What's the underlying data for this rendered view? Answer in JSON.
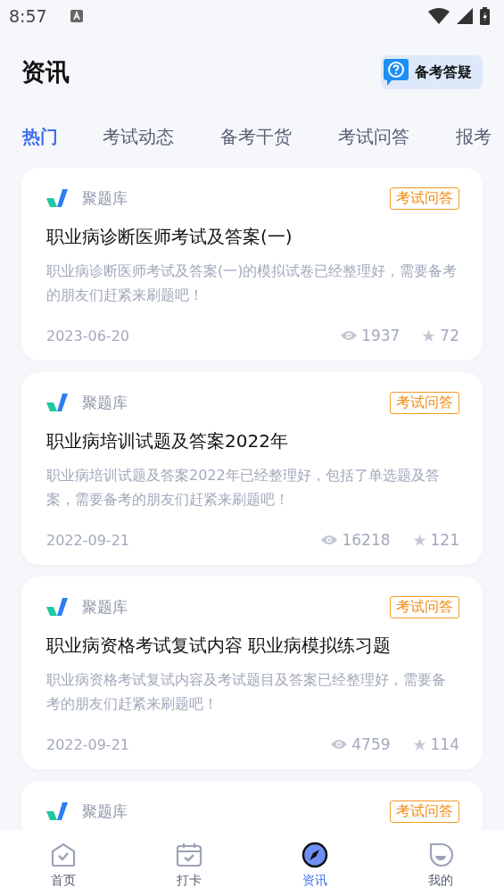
{
  "status_bar": {
    "time": "8:57"
  },
  "header": {
    "title": "资讯",
    "qa_button": "备考答疑"
  },
  "tabs": [
    {
      "label": "热门",
      "selected": true
    },
    {
      "label": "考试动态",
      "selected": false
    },
    {
      "label": "备考干货",
      "selected": false
    },
    {
      "label": "考试问答",
      "selected": false
    },
    {
      "label": "报考",
      "selected": false
    }
  ],
  "articles": [
    {
      "source": "聚题库",
      "tag": "考试问答",
      "title": "职业病诊断医师考试及答案(一)",
      "summary": "职业病诊断医师考试及答案(一)的模拟试卷已经整理好，需要备考的朋友们赶紧来刷题吧！",
      "date": "2023-06-20",
      "views": "1937",
      "favorites": "72"
    },
    {
      "source": "聚题库",
      "tag": "考试问答",
      "title": "职业病培训试题及答案2022年",
      "summary": "职业病培训试题及答案2022年已经整理好，包括了单选题及答案，需要备考的朋友们赶紧来刷题吧！",
      "date": "2022-09-21",
      "views": "16218",
      "favorites": "121"
    },
    {
      "source": "聚题库",
      "tag": "考试问答",
      "title": "职业病资格考试复试内容 职业病模拟练习题",
      "summary": "职业病资格考试复试内容及考试题目及答案已经整理好，需要备考的朋友们赶紧来刷题吧！",
      "date": "2022-09-21",
      "views": "4759",
      "favorites": "114"
    },
    {
      "source": "聚题库",
      "tag": "考试问答"
    }
  ],
  "bottom_nav": [
    {
      "label": "首页",
      "kind": "home",
      "selected": false
    },
    {
      "label": "打卡",
      "kind": "calendar",
      "selected": false
    },
    {
      "label": "资讯",
      "kind": "compass",
      "selected": true
    },
    {
      "label": "我的",
      "kind": "profile",
      "selected": false
    }
  ]
}
